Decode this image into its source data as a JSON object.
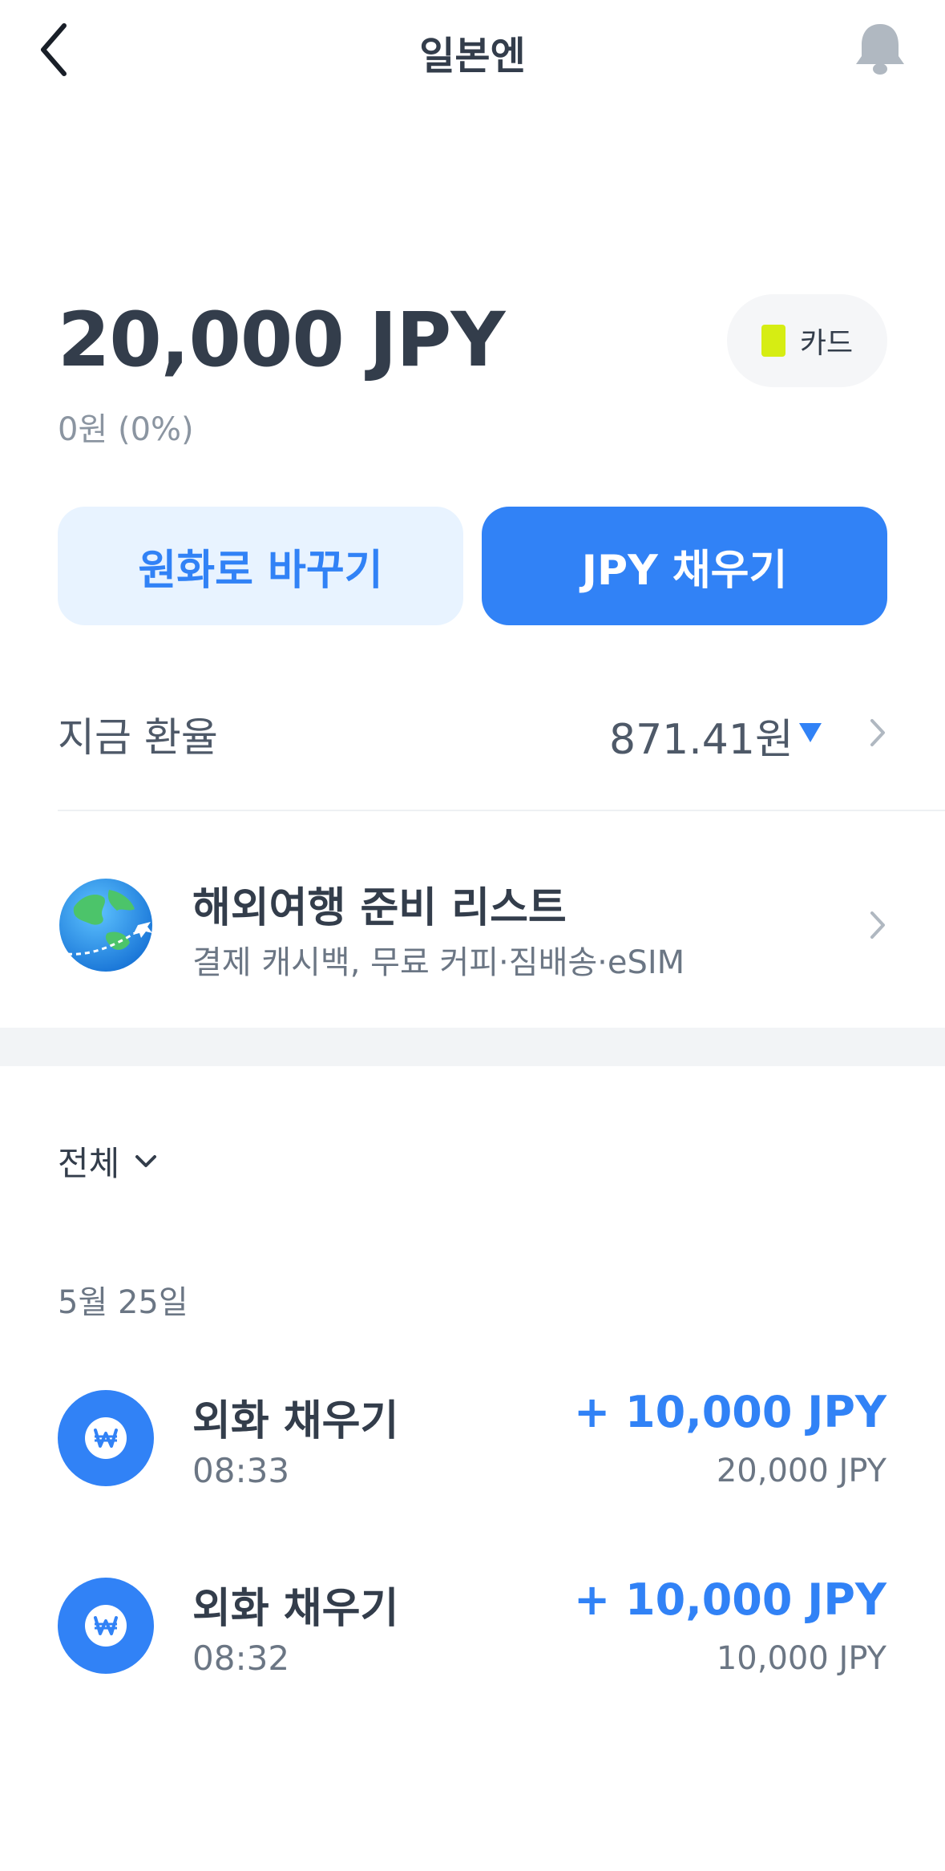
{
  "header": {
    "title": "일본엔"
  },
  "balance": {
    "amount": "20,000 JPY",
    "krw_value": "0원 (0%)"
  },
  "card_chip": {
    "label": "카드",
    "chip_color": "#d6ed13"
  },
  "actions": {
    "to_krw_label": "원화로 바꾸기",
    "fill_label": "JPY 채우기"
  },
  "exchange_rate": {
    "label": "지금 환율",
    "value": "871.41원",
    "trend": "down"
  },
  "travel_banner": {
    "title": "해외여행 준비 리스트",
    "subtitle": "결제 캐시백, 무료 커피·짐배송·eSIM",
    "icon": "globe-airplane-icon"
  },
  "filter": {
    "selected": "전체"
  },
  "date_group": "5월 25일",
  "transactions": [
    {
      "title": "외화 채우기",
      "time": "08:33",
      "amount": "+ 10,000 JPY",
      "balance_after": "20,000 JPY",
      "icon": "won-icon"
    },
    {
      "title": "외화 채우기",
      "time": "08:32",
      "amount": "+ 10,000 JPY",
      "balance_after": "10,000 JPY",
      "icon": "won-icon"
    }
  ],
  "colors": {
    "accent": "#3182f6",
    "accent_light": "#e8f3ff",
    "text_primary": "#333d4b",
    "text_secondary": "#6b7684"
  }
}
